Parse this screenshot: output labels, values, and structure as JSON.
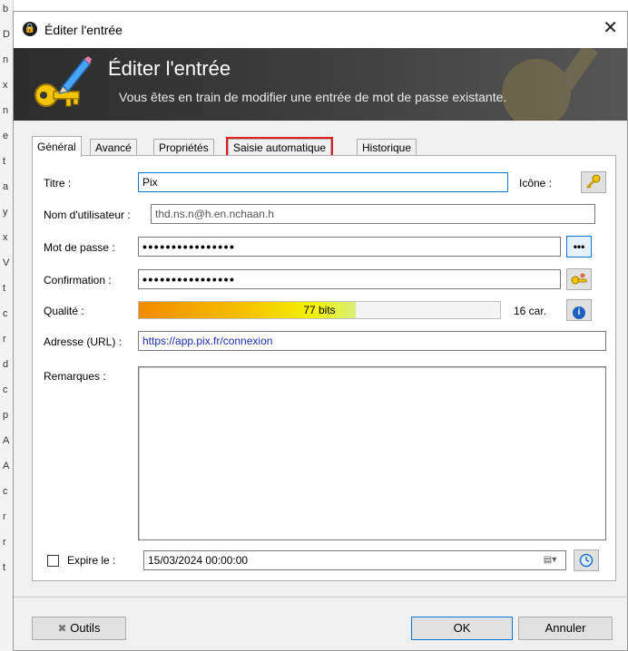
{
  "window": {
    "title": "Éditer l'entrée",
    "close_glyph": "✕"
  },
  "banner": {
    "title": "Éditer l'entrée",
    "subtitle": "Vous êtes en train de modifier une entrée de mot de passe existante."
  },
  "tabs": [
    {
      "label": "Général",
      "active": true
    },
    {
      "label": "Avancé",
      "active": false
    },
    {
      "label": "Propriétés",
      "active": false
    },
    {
      "label": "Saisie automatique",
      "active": false,
      "highlighted": true
    },
    {
      "label": "Historique",
      "active": false
    }
  ],
  "form": {
    "title_label": "Titre :",
    "title_value": "Pix",
    "icon_label": "Icône :",
    "username_label": "Nom d'utilisateur :",
    "username_value": "thd.ns.n@h.en.nchaan.h",
    "password_label": "Mot de passe :",
    "password_value": "••••••••••••••••",
    "show_password_glyph": "•••",
    "confirm_label": "Confirmation :",
    "confirm_value": "••••••••••••••••",
    "quality_label": "Qualité :",
    "quality_text": "77 bits",
    "quality_fraction": 0.6,
    "char_count": "16 car.",
    "info_glyph": "i",
    "url_label": "Adresse (URL) :",
    "url_value": "https://app.pix.fr/connexion",
    "notes_label": "Remarques :",
    "notes_value": "",
    "expires_label": "Expire le :",
    "expires_checked": false,
    "expires_value": "15/03/2024 00:00:00"
  },
  "footer": {
    "tools_label": "Outils",
    "ok_label": "OK",
    "cancel_label": "Annuler"
  },
  "colors": {
    "focus_blue": "#0078d7",
    "tab_highlight": "#e02020",
    "url_text": "#1a2fa8"
  },
  "background_strip": [
    "b",
    "D",
    "n",
    "x",
    "n",
    "e",
    "t",
    "a",
    "y",
    "x",
    "V",
    "t",
    "c",
    "r",
    "d",
    "c",
    "p",
    "A",
    "A",
    "c",
    "r",
    "r",
    "t"
  ]
}
